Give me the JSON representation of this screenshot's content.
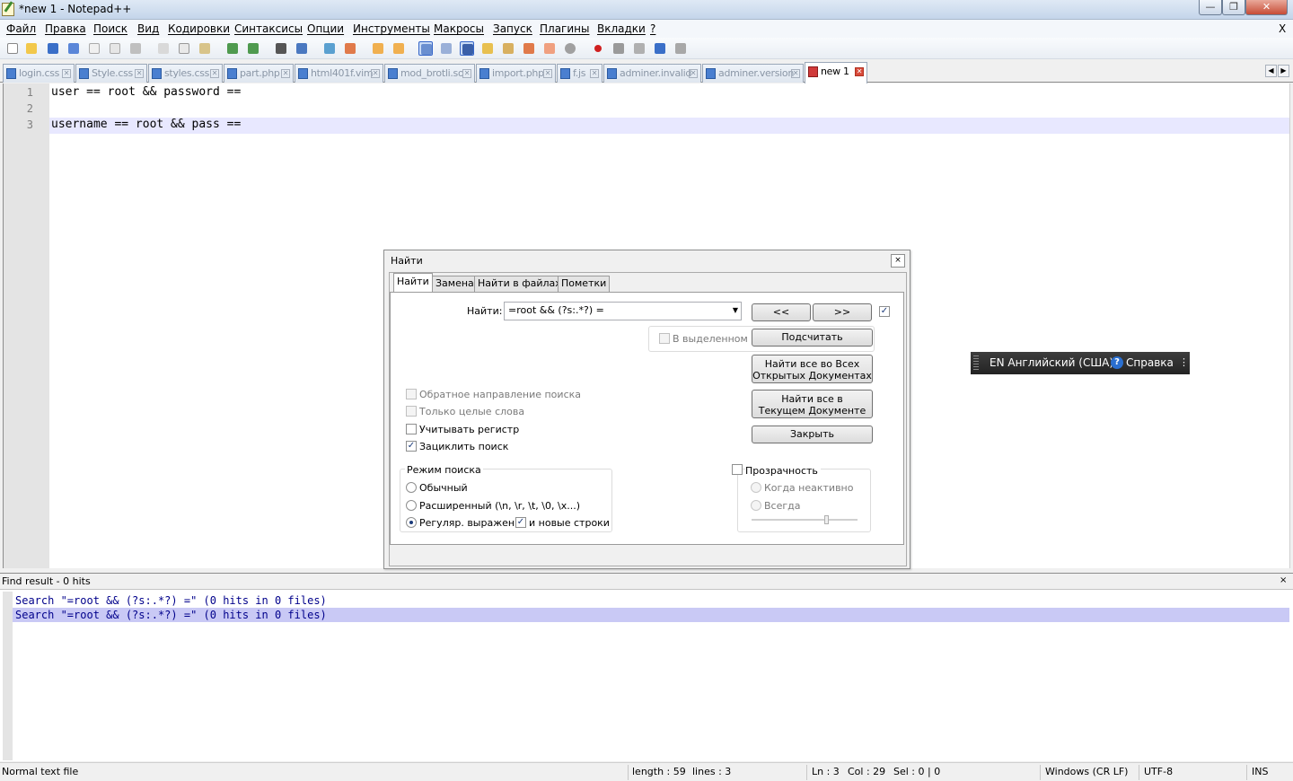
{
  "window": {
    "title": "*new 1 - Notepad++",
    "min": "—",
    "max": "❐",
    "close": "✕"
  },
  "menu": {
    "items": [
      "Файл",
      "Правка",
      "Поиск",
      "Вид",
      "Кодировки",
      "Синтаксисы",
      "Опции",
      "Инструменты",
      "Макросы",
      "Запуск",
      "Плагины",
      "Вкладки",
      "?"
    ],
    "close": "X"
  },
  "toolbar": {
    "icons": [
      "new-file",
      "open-file",
      "save",
      "save-all",
      "close",
      "close-all",
      "print",
      "cut",
      "copy",
      "paste",
      "undo",
      "redo",
      "find",
      "replace",
      "zoom-in",
      "zoom-out",
      "sync-vertical",
      "sync-horizontal",
      "word-wrap",
      "show-all-chars",
      "indent-guide",
      "user-define-lang",
      "doc-map",
      "function-list",
      "folder-workspace",
      "monitoring",
      "record-macro",
      "stop-record",
      "play-macro",
      "run-macro-multiple",
      "save-macro"
    ]
  },
  "tabs": [
    {
      "label": "login.css"
    },
    {
      "label": "Style.css"
    },
    {
      "label": "styles.css"
    },
    {
      "label": "part.php"
    },
    {
      "label": "html401f.vim"
    },
    {
      "label": "mod_brotli.so"
    },
    {
      "label": "import.php"
    },
    {
      "label": "f.js"
    },
    {
      "label": "adminer.invalid"
    },
    {
      "label": "adminer.version"
    },
    {
      "label": "new 1",
      "active": true
    }
  ],
  "editor": {
    "lines": [
      {
        "num": "1",
        "text": "user == root && password =="
      },
      {
        "num": "2",
        "text": ""
      },
      {
        "num": "3",
        "text": "username == root && pass =="
      }
    ]
  },
  "find_dialog": {
    "title": "Найти",
    "close": "×",
    "tabs": [
      "Найти",
      "Замена",
      "Найти в файлах",
      "Пометки"
    ],
    "find_label": "Найти:",
    "find_value": "=root && (?s:.*?) =",
    "prev_btn": "<<",
    "next_btn": ">>",
    "in_selection": "В выделенном",
    "count_btn": "Подсчитать",
    "find_all_open_line1": "Найти все во Всех",
    "find_all_open_line2": "Открытых Документах",
    "find_all_current_line1": "Найти все в",
    "find_all_current_line2": "Текущем Документе",
    "close_btn": "Закрыть",
    "options": {
      "backward": "Обратное направление поиска",
      "whole_word": "Только целые слова",
      "match_case": "Учитывать регистр",
      "wrap": "Зациклить поиск"
    },
    "search_mode": {
      "title": "Режим поиска",
      "normal": "Обычный",
      "extended": "Расширенный (\\n, \\r, \\t, \\0, \\x...)",
      "regex": "Регуляр. выражен.",
      "newline": "и новые строки",
      "selected": "regex"
    },
    "transparency": {
      "title": "Прозрачность",
      "on_lose_focus": "Когда неактивно",
      "always": "Всегда",
      "level": 0.7
    }
  },
  "lang_bar": {
    "language": "EN Английский (США)",
    "help_icon": "?",
    "help": "Справка",
    "more": "⋮"
  },
  "results": {
    "title": "Find result - 0 hits",
    "close": "×",
    "lines": [
      "Search \"=root && (?s:.*?) =\" (0 hits in 0 files)",
      "Search \"=root && (?s:.*?) =\" (0 hits in 0 files)"
    ]
  },
  "status": {
    "type": "Normal text file",
    "length": "length : 59",
    "lines": "lines : 3",
    "ln": "Ln : 3",
    "col": "Col : 29",
    "sel": "Sel : 0 | 0",
    "eol": "Windows (CR LF)",
    "encoding": "UTF-8",
    "mode": "INS"
  },
  "colors": {
    "title_bg": "#c4d5ea",
    "current_line": "#e8e8ff",
    "result_highlight": "#c9c9f5",
    "result_text": "#00008b"
  }
}
